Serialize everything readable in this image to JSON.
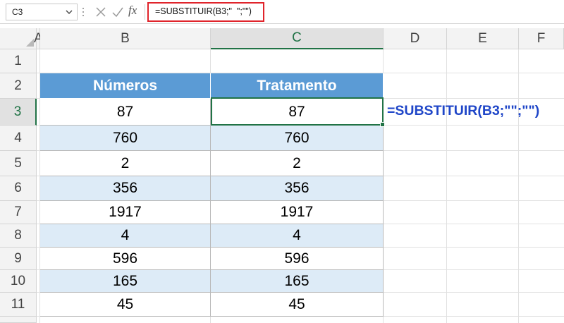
{
  "formula_bar": {
    "name_box": "C3",
    "fx_label": "fx",
    "formula": "=SUBSTITUIR(B3;\"  \";\"\")"
  },
  "columns": [
    "A",
    "B",
    "C",
    "D",
    "E",
    "F"
  ],
  "rows": [
    "1",
    "2",
    "3",
    "4",
    "5",
    "6",
    "7",
    "8",
    "9",
    "10",
    "11"
  ],
  "table": {
    "headers": [
      "Números",
      "Tratamento"
    ],
    "rows": [
      [
        "87",
        "87"
      ],
      [
        "760",
        "760"
      ],
      [
        "2",
        "2"
      ],
      [
        "356",
        "356"
      ],
      [
        "1917",
        "1917"
      ],
      [
        "4",
        "4"
      ],
      [
        "596",
        "596"
      ],
      [
        "165",
        "165"
      ],
      [
        "45",
        "45"
      ]
    ]
  },
  "annotation": "=SUBSTITUIR(B3;\"\";\"\")",
  "colors": {
    "header_fill": "#5b9bd5",
    "band_fill": "#ddebf7",
    "selection": "#217346",
    "formula_highlight": "#e0242b",
    "annotation_text": "#1f46c8"
  }
}
